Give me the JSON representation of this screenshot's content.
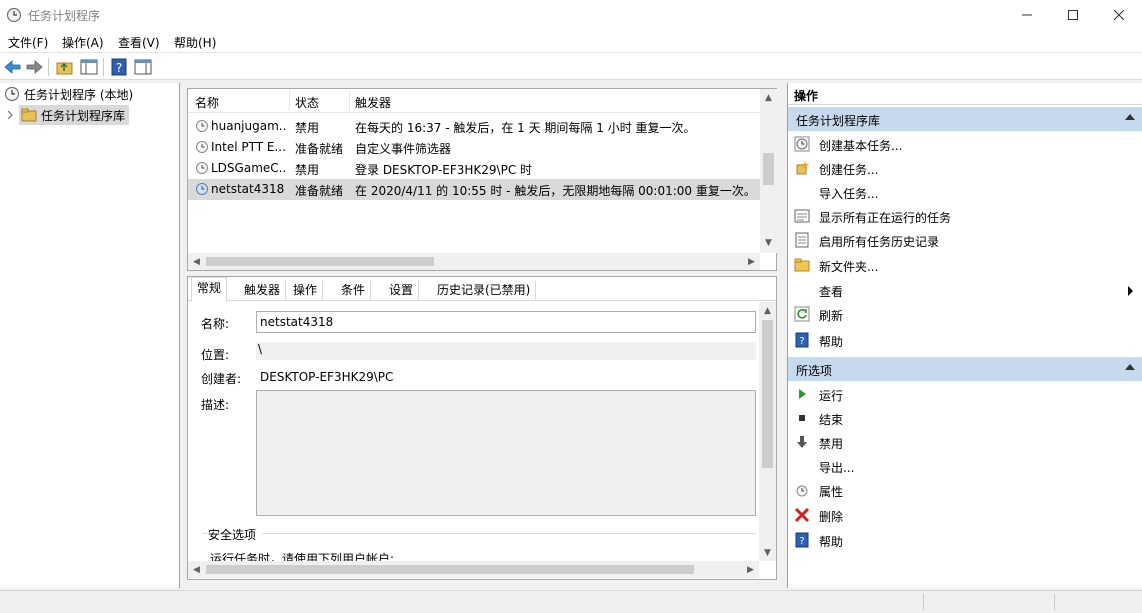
{
  "window": {
    "title": "任务计划程序"
  },
  "menu": [
    "文件(F)",
    "操作(A)",
    "查看(V)",
    "帮助(H)"
  ],
  "tree": {
    "root": "任务计划程序 (本地)",
    "child": "任务计划程序库"
  },
  "task_list": {
    "columns": [
      "名称",
      "状态",
      "触发器"
    ],
    "rows": [
      {
        "name": "huanjugam...",
        "status": "禁用",
        "trigger": "在每天的 16:37 - 触发后，在 1 天 期间每隔 1 小时 重复一次。"
      },
      {
        "name": "Intel PTT E...",
        "status": "准备就绪",
        "trigger": "自定义事件筛选器"
      },
      {
        "name": "LDSGameC...",
        "status": "禁用",
        "trigger": "登录 DESKTOP-EF3HK29\\PC 时"
      },
      {
        "name": "netstat4318",
        "status": "准备就绪",
        "trigger": "在 2020/4/11 的 10:55 时 - 触发后，无限期地每隔 00:01:00 重复一次。"
      }
    ]
  },
  "detail": {
    "tabs": [
      "常规",
      "触发器",
      "操作",
      "条件",
      "设置",
      "历史记录(已禁用)"
    ],
    "name_label": "名称:",
    "name_value": "netstat4318",
    "location_label": "位置:",
    "location_value": "\\",
    "author_label": "创建者:",
    "author_value": "DESKTOP-EF3HK29\\PC",
    "desc_label": "描述:",
    "security_group": "安全选项",
    "run_as_text": "运行任务时，请使用下列用户帐户:"
  },
  "actions": {
    "header": "操作",
    "section1": "任务计划程序库",
    "items1": [
      "创建基本任务...",
      "创建任务...",
      "导入任务...",
      "显示所有正在运行的任务",
      "启用所有任务历史记录",
      "新文件夹...",
      "查看",
      "刷新",
      "帮助"
    ],
    "section2": "所选项",
    "items2": [
      "运行",
      "结束",
      "禁用",
      "导出...",
      "属性",
      "删除",
      "帮助"
    ]
  },
  "colors": {
    "section_bg": "#c7d9ec",
    "selection": "#d9d9d9",
    "accent_green": "#2a9a2a",
    "delete_red": "#d02020"
  }
}
